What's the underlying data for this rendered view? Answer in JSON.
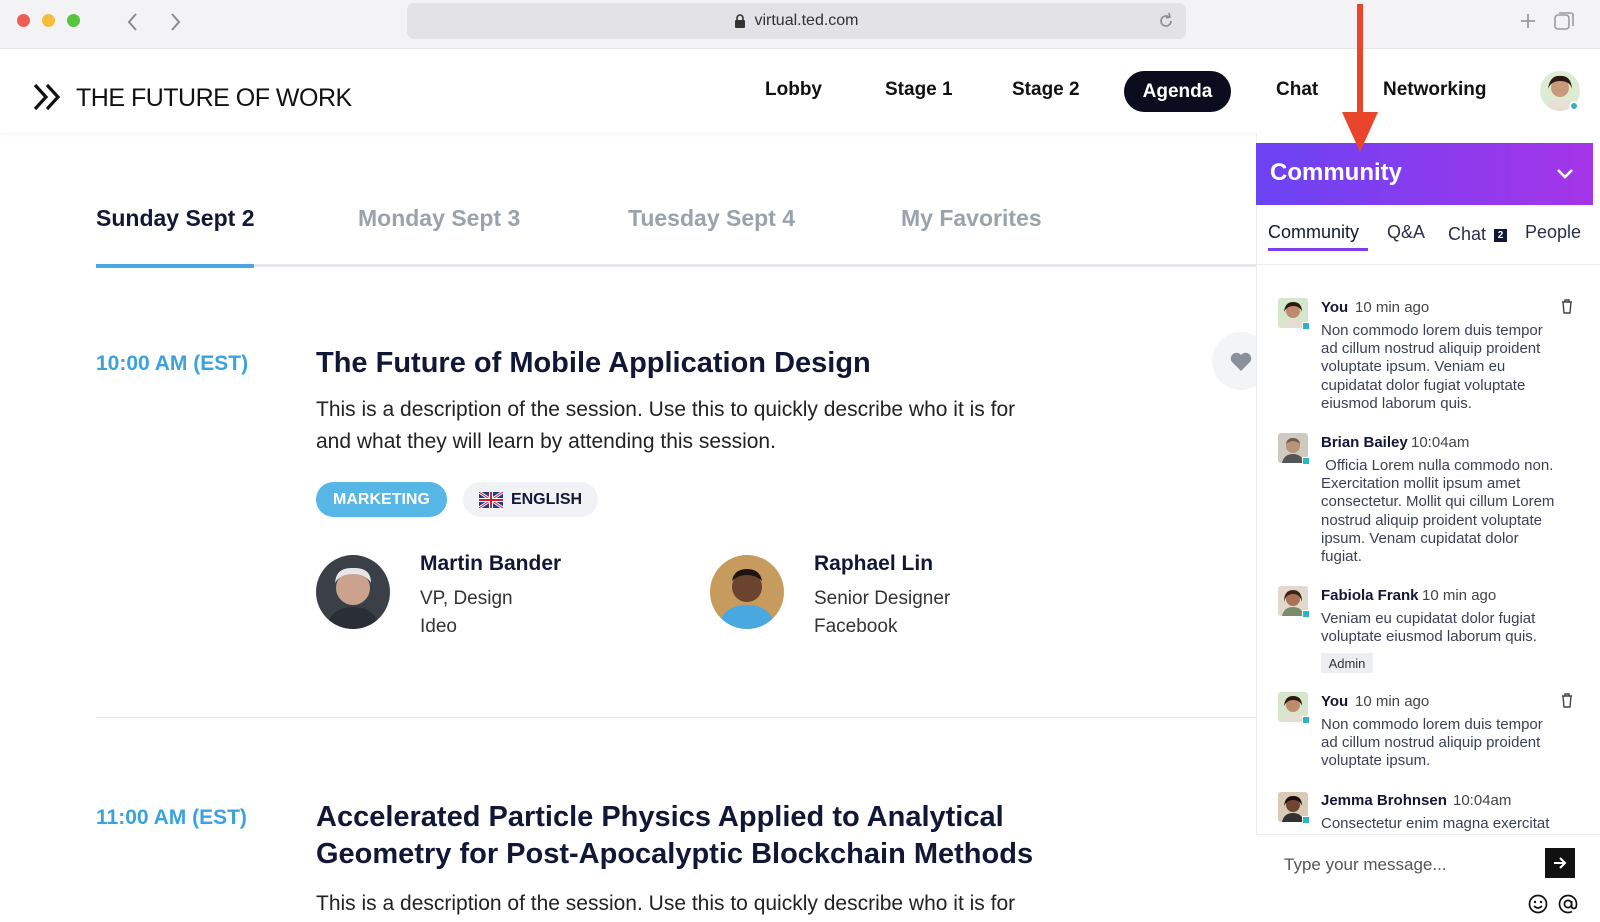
{
  "browser": {
    "url": "virtual.ted.com"
  },
  "site": {
    "title": "THE FUTURE OF WORK"
  },
  "nav": {
    "lobby": "Lobby",
    "stage1": "Stage 1",
    "stage2": "Stage 2",
    "agenda": "Agenda",
    "chat": "Chat",
    "networking": "Networking"
  },
  "day_tabs": [
    "Sunday Sept 2",
    "Monday Sept 3",
    "Tuesday Sept 4",
    "My Favorites"
  ],
  "sessions": [
    {
      "time": "10:00 AM (EST)",
      "title": "The Future of Mobile Application Design",
      "description_line1": "This is a description of the session. Use this to quickly describe who it is for",
      "description_line2": "and what they will learn by attending this session.",
      "tag": "MARKETING",
      "language": "ENGLISH",
      "speakers": [
        {
          "name": "Martin Bander",
          "role": "VP, Design",
          "company": "Ideo"
        },
        {
          "name": "Raphael Lin",
          "role": "Senior Designer",
          "company": "Facebook"
        }
      ]
    },
    {
      "time": "11:00 AM (EST)",
      "title_line1": "Accelerated Particle Physics Applied to Analytical",
      "title_line2": "Geometry for Post-Apocalyptic Blockchain Methods",
      "description_line1": "This is a description of the session. Use this to quickly describe who it is for"
    }
  ],
  "community": {
    "header": "Community",
    "tabs": {
      "community": "Community",
      "qa": "Q&A",
      "chat": "Chat",
      "chat_badge": "2",
      "people": "People"
    },
    "messages": [
      {
        "author": "You",
        "time": "10 min ago",
        "text": [
          "Non commodo lorem duis tempor",
          "ad cillum nostrud aliquip proident",
          "voluptate ipsum. Veniam eu",
          "cupidatat dolor fugiat voluptate",
          "eiusmod laborum quis."
        ]
      },
      {
        "author": "Brian Bailey",
        "time": "10:04am",
        "text": [
          " Officia Lorem nulla commodo non.",
          "Exercitation mollit ipsum amet",
          "consectetur. Mollit qui cillum Lorem",
          "nostrud aliquip proident voluptate",
          "ipsum. Venam cupidatat dolor",
          "fugiat."
        ]
      },
      {
        "author": "Fabiola Frank",
        "time": "10 min ago",
        "text": [
          "Veniam eu cupidatat dolor fugiat",
          "voluptate eiusmod laborum quis."
        ],
        "badge": "Admin"
      },
      {
        "author": "You",
        "time": "10 min ago",
        "text": [
          "Non commodo lorem duis tempor",
          "ad cillum nostrud aliquip proident",
          "voluptate ipsum."
        ]
      },
      {
        "author": "Jemma Brohnsen",
        "time": "10:04am",
        "text": [
          "Consectetur enim magna exercitat"
        ]
      }
    ],
    "input_placeholder": "Type your message..."
  },
  "colors": {
    "accent_blue": "#3aa3dd",
    "navy": "#121735",
    "purple_start": "#6a43f2",
    "purple_end": "#a535e8",
    "annotation_red": "#e8452c"
  }
}
